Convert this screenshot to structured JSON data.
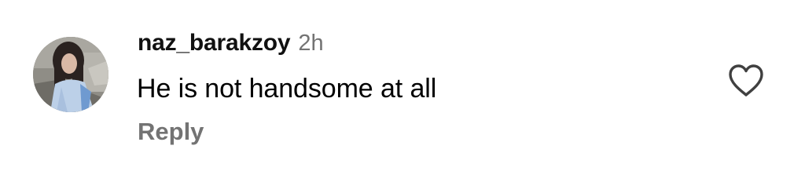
{
  "comment": {
    "username": "naz_barakzoy",
    "timestamp": "2h",
    "text": "He is not handsome at all",
    "reply_label": "Reply",
    "like_icon": "heart-outline-icon"
  },
  "colors": {
    "text": "#000000",
    "secondary_text": "#737373",
    "icon": "#404040",
    "background": "#ffffff"
  }
}
